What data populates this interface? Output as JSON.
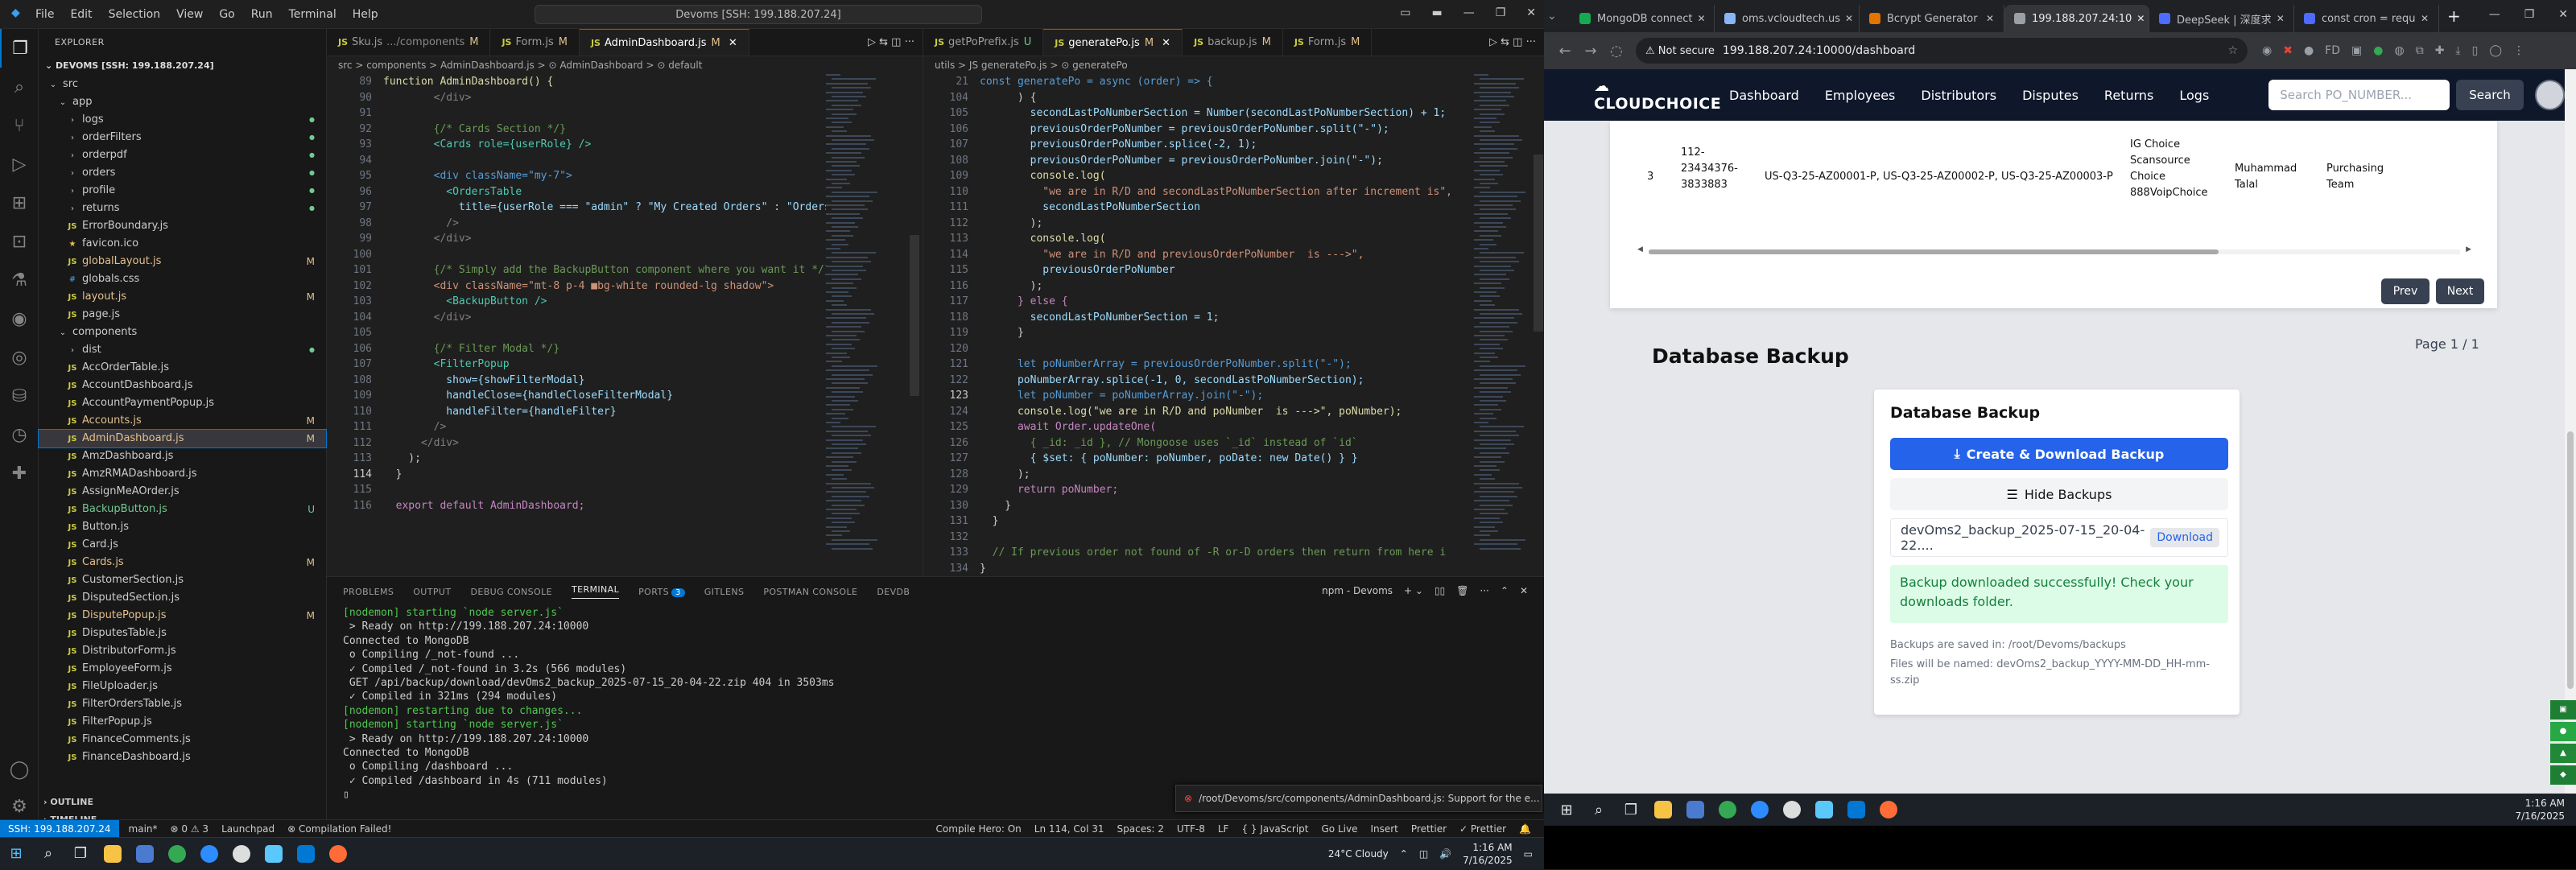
{
  "vscode": {
    "menu": [
      "File",
      "Edit",
      "Selection",
      "View",
      "Go",
      "Run",
      "Terminal",
      "Help"
    ],
    "command_center": "Devoms [SSH: 199.188.207.24]",
    "explorer_label": "EXPLORER",
    "project": "DEVOMS [SSH: 199.188.207.24]",
    "tree": [
      {
        "label": "src",
        "indent": 0,
        "kind": "folder-open",
        "status": "",
        "sc": ""
      },
      {
        "label": "app",
        "indent": 1,
        "kind": "folder-open",
        "status": "",
        "sc": ""
      },
      {
        "label": "logs",
        "indent": 2,
        "kind": "folder",
        "status": "",
        "sc": ""
      },
      {
        "label": "orderFilters",
        "indent": 2,
        "kind": "folder",
        "status": "",
        "sc": ""
      },
      {
        "label": "orderpdf",
        "indent": 2,
        "kind": "folder",
        "status": "",
        "sc": ""
      },
      {
        "label": "orders",
        "indent": 2,
        "kind": "folder",
        "status": "",
        "sc": ""
      },
      {
        "label": "profile",
        "indent": 2,
        "kind": "folder",
        "status": "",
        "sc": ""
      },
      {
        "label": "returns",
        "indent": 2,
        "kind": "folder",
        "status": "",
        "sc": ""
      },
      {
        "label": "ErrorBoundary.js",
        "indent": 2,
        "kind": "js",
        "status": "",
        "sc": ""
      },
      {
        "label": "favicon.ico",
        "indent": 2,
        "kind": "ico",
        "status": "",
        "sc": ""
      },
      {
        "label": "globalLayout.js",
        "indent": 2,
        "kind": "js",
        "status": "M",
        "sc": "#e2c08d"
      },
      {
        "label": "globals.css",
        "indent": 2,
        "kind": "css",
        "status": "",
        "sc": ""
      },
      {
        "label": "layout.js",
        "indent": 2,
        "kind": "js",
        "status": "M",
        "sc": "#e2c08d"
      },
      {
        "label": "page.js",
        "indent": 2,
        "kind": "js",
        "status": "",
        "sc": ""
      },
      {
        "label": "components",
        "indent": 1,
        "kind": "folder-open",
        "status": "",
        "sc": ""
      },
      {
        "label": "dist",
        "indent": 2,
        "kind": "folder",
        "status": "",
        "sc": ""
      },
      {
        "label": "AccOrderTable.js",
        "indent": 2,
        "kind": "js",
        "status": "",
        "sc": ""
      },
      {
        "label": "AccountDashboard.js",
        "indent": 2,
        "kind": "js",
        "status": "",
        "sc": ""
      },
      {
        "label": "AccountPaymentPopup.js",
        "indent": 2,
        "kind": "js",
        "status": "",
        "sc": ""
      },
      {
        "label": "Accounts.js",
        "indent": 2,
        "kind": "js",
        "status": "M",
        "sc": "#e2c08d"
      },
      {
        "label": "AdminDashboard.js",
        "indent": 2,
        "kind": "js",
        "status": "M",
        "sc": "#e2c08d",
        "sel": true
      },
      {
        "label": "AmzDashboard.js",
        "indent": 2,
        "kind": "js",
        "status": "",
        "sc": ""
      },
      {
        "label": "AmzRMADashboard.js",
        "indent": 2,
        "kind": "js",
        "status": "",
        "sc": ""
      },
      {
        "label": "AssignMeAOrder.js",
        "indent": 2,
        "kind": "js",
        "status": "",
        "sc": ""
      },
      {
        "label": "BackupButton.js",
        "indent": 2,
        "kind": "js",
        "status": "U",
        "sc": "#73c991"
      },
      {
        "label": "Button.js",
        "indent": 2,
        "kind": "js",
        "status": "",
        "sc": ""
      },
      {
        "label": "Card.js",
        "indent": 2,
        "kind": "js",
        "status": "",
        "sc": ""
      },
      {
        "label": "Cards.js",
        "indent": 2,
        "kind": "js",
        "status": "M",
        "sc": "#e2c08d"
      },
      {
        "label": "CustomerSection.js",
        "indent": 2,
        "kind": "js",
        "status": "",
        "sc": ""
      },
      {
        "label": "DisputedSection.js",
        "indent": 2,
        "kind": "js",
        "status": "",
        "sc": ""
      },
      {
        "label": "DisputePopup.js",
        "indent": 2,
        "kind": "js",
        "status": "M",
        "sc": "#e2c08d"
      },
      {
        "label": "DisputesTable.js",
        "indent": 2,
        "kind": "js",
        "status": "",
        "sc": ""
      },
      {
        "label": "DistributorForm.js",
        "indent": 2,
        "kind": "js",
        "status": "",
        "sc": ""
      },
      {
        "label": "EmployeeForm.js",
        "indent": 2,
        "kind": "js",
        "status": "",
        "sc": ""
      },
      {
        "label": "FileUploader.js",
        "indent": 2,
        "kind": "js",
        "status": "",
        "sc": ""
      },
      {
        "label": "FilterOrdersTable.js",
        "indent": 2,
        "kind": "js",
        "status": "",
        "sc": ""
      },
      {
        "label": "FilterPopup.js",
        "indent": 2,
        "kind": "js",
        "status": "",
        "sc": ""
      },
      {
        "label": "FinanceComments.js",
        "indent": 2,
        "kind": "js",
        "status": "",
        "sc": ""
      },
      {
        "label": "FinanceDashboard.js",
        "indent": 2,
        "kind": "js",
        "status": "",
        "sc": ""
      }
    ],
    "outline": "OUTLINE",
    "timeline": "TIMELINE",
    "left_tabs": [
      {
        "label": "Sku.js",
        "desc": ".../components",
        "status": "M",
        "active": false
      },
      {
        "label": "Form.js",
        "desc": "",
        "status": "M",
        "active": false
      },
      {
        "label": "AdminDashboard.js",
        "desc": "",
        "status": "M",
        "active": true
      }
    ],
    "left_crumb": "src > components > AdminDashboard.js > ⊙ AdminDashboard > ⊙ default",
    "left_code": [
      {
        "n": "89",
        "t": "function AdminDashboard() {",
        "c": "#dcdcaa"
      },
      {
        "n": "90",
        "t": "        </div>",
        "c": "#808080"
      },
      {
        "n": "91",
        "t": "",
        "c": "#ccc"
      },
      {
        "n": "92",
        "t": "        {/* Cards Section */}",
        "c": "#6a9955"
      },
      {
        "n": "93",
        "t": "        <Cards role={userRole} />",
        "c": "#4ec9b0"
      },
      {
        "n": "94",
        "t": "",
        "c": "#ccc"
      },
      {
        "n": "95",
        "t": "        <div className=\"my-7\">",
        "c": "#569cd6"
      },
      {
        "n": "96",
        "t": "          <OrdersTable",
        "c": "#4ec9b0"
      },
      {
        "n": "97",
        "t": "            title={userRole === \"admin\" ? \"My Created Orders\" : \"Orders\"}",
        "c": "#9cdcfe"
      },
      {
        "n": "98",
        "t": "          />",
        "c": "#808080"
      },
      {
        "n": "99",
        "t": "        </div>",
        "c": "#808080"
      },
      {
        "n": "100",
        "t": "",
        "c": "#ccc"
      },
      {
        "n": "101",
        "t": "        {/* Simply add the BackupButton component where you want it */}",
        "c": "#6a9955"
      },
      {
        "n": "102",
        "t": "        <div className=\"mt-8 p-4 ■bg-white rounded-lg shadow\">",
        "c": "#ce9178"
      },
      {
        "n": "103",
        "t": "          <BackupButton />",
        "c": "#4ec9b0"
      },
      {
        "n": "104",
        "t": "        </div>",
        "c": "#808080"
      },
      {
        "n": "105",
        "t": "",
        "c": "#ccc"
      },
      {
        "n": "106",
        "t": "        {/* Filter Modal */}",
        "c": "#6a9955"
      },
      {
        "n": "107",
        "t": "        <FilterPopup",
        "c": "#4ec9b0"
      },
      {
        "n": "108",
        "t": "          show={showFilterModal}",
        "c": "#9cdcfe"
      },
      {
        "n": "109",
        "t": "          handleClose={handleCloseFilterModal}",
        "c": "#9cdcfe"
      },
      {
        "n": "110",
        "t": "          handleFilter={handleFilter}",
        "c": "#9cdcfe"
      },
      {
        "n": "111",
        "t": "        />",
        "c": "#808080"
      },
      {
        "n": "112",
        "t": "      </div>",
        "c": "#808080"
      },
      {
        "n": "113",
        "t": "    );",
        "c": "#ccc"
      },
      {
        "n": "114",
        "t": "  }",
        "c": "#ccc"
      },
      {
        "n": "115",
        "t": "",
        "c": "#ccc"
      },
      {
        "n": "116",
        "t": "  export default AdminDashboard;",
        "c": "#c586c0"
      }
    ],
    "right_tabs": [
      {
        "label": "getPoPrefix.js",
        "desc": "",
        "status": "U",
        "active": false
      },
      {
        "label": "generatePo.js",
        "desc": "",
        "status": "M",
        "active": true
      },
      {
        "label": "backup.js",
        "desc": "",
        "status": "M",
        "active": false
      },
      {
        "label": "Form.js",
        "desc": "",
        "status": "M",
        "active": false
      }
    ],
    "right_crumb": "utils > JS generatePo.js > ⊙ generatePo",
    "right_code": [
      {
        "n": "21",
        "t": "const generatePo = async (order) => {",
        "c": "#569cd6"
      },
      {
        "n": "104",
        "t": "      ) {",
        "c": "#ccc"
      },
      {
        "n": "105",
        "t": "        secondLastPoNumberSection = Number(secondLastPoNumberSection) + 1;",
        "c": "#9cdcfe"
      },
      {
        "n": "106",
        "t": "        previousOrderPoNumber = previousOrderPoNumber.split(\"-\");",
        "c": "#9cdcfe"
      },
      {
        "n": "107",
        "t": "        previousOrderPoNumber.splice(-2, 1);",
        "c": "#9cdcfe"
      },
      {
        "n": "108",
        "t": "        previousOrderPoNumber = previousOrderPoNumber.join(\"-\");",
        "c": "#9cdcfe"
      },
      {
        "n": "109",
        "t": "        console.log(",
        "c": "#dcdcaa"
      },
      {
        "n": "110",
        "t": "          \"we are in R/D and secondLastPoNumberSection after increment is\",",
        "c": "#ce9178"
      },
      {
        "n": "111",
        "t": "          secondLastPoNumberSection",
        "c": "#9cdcfe"
      },
      {
        "n": "112",
        "t": "        );",
        "c": "#ccc"
      },
      {
        "n": "113",
        "t": "        console.log(",
        "c": "#dcdcaa"
      },
      {
        "n": "114",
        "t": "          \"we are in R/D and previousOrderPoNumber  is --->\",",
        "c": "#ce9178"
      },
      {
        "n": "115",
        "t": "          previousOrderPoNumber",
        "c": "#9cdcfe"
      },
      {
        "n": "116",
        "t": "        );",
        "c": "#ccc"
      },
      {
        "n": "117",
        "t": "      } else {",
        "c": "#c586c0"
      },
      {
        "n": "118",
        "t": "        secondLastPoNumberSection = 1;",
        "c": "#9cdcfe"
      },
      {
        "n": "119",
        "t": "      }",
        "c": "#ccc"
      },
      {
        "n": "120",
        "t": "",
        "c": "#ccc"
      },
      {
        "n": "121",
        "t": "      let poNumberArray = previousOrderPoNumber.split(\"-\");",
        "c": "#569cd6"
      },
      {
        "n": "122",
        "t": "      poNumberArray.splice(-1, 0, secondLastPoNumberSection);",
        "c": "#9cdcfe"
      },
      {
        "n": "123",
        "t": "      let poNumber = poNumberArray.join(\"-\");",
        "c": "#569cd6"
      },
      {
        "n": "124",
        "t": "      console.log(\"we are in R/D and poNumber  is --->\", poNumber);",
        "c": "#dcdcaa"
      },
      {
        "n": "125",
        "t": "      await Order.updateOne(",
        "c": "#c586c0"
      },
      {
        "n": "126",
        "t": "        { _id: _id }, // Mongoose uses `_id` instead of `id`",
        "c": "#6a9955"
      },
      {
        "n": "127",
        "t": "        { $set: { poNumber: poNumber, poDate: new Date() } }",
        "c": "#9cdcfe"
      },
      {
        "n": "128",
        "t": "      );",
        "c": "#ccc"
      },
      {
        "n": "129",
        "t": "      return poNumber;",
        "c": "#c586c0"
      },
      {
        "n": "130",
        "t": "    }",
        "c": "#ccc"
      },
      {
        "n": "131",
        "t": "  }",
        "c": "#ccc"
      },
      {
        "n": "132",
        "t": "",
        "c": "#ccc"
      },
      {
        "n": "133",
        "t": "  // If previous order not found of -R or-D orders then return from here i",
        "c": "#6a9955"
      },
      {
        "n": "134",
        "t": "}",
        "c": "#ccc"
      }
    ],
    "panel_tabs": [
      "PROBLEMS",
      "OUTPUT",
      "DEBUG CONSOLE",
      "TERMINAL",
      "PORTS",
      "GITLENS",
      "POSTMAN CONSOLE",
      "DEVDB"
    ],
    "ports_badge": "3",
    "terminal_name": "npm - Devoms",
    "terminal": [
      {
        "t": "[nodemon] starting `node server.js`",
        "c": "#4ec94e"
      },
      {
        "t": " > Ready on http://199.188.207.24:10000",
        "c": "#ccc"
      },
      {
        "t": "Connected to MongoDB",
        "c": "#ccc"
      },
      {
        "t": " o Compiling /_not-found ...",
        "c": "#ccc"
      },
      {
        "t": " ✓ Compiled /_not-found in 3.2s (566 modules)",
        "c": "#ccc"
      },
      {
        "t": " GET /api/backup/download/devOms2_backup_2025-07-15_20-04-22.zip 404 in 3503ms",
        "c": "#ccc"
      },
      {
        "t": " ✓ Compiled in 321ms (294 modules)",
        "c": "#ccc"
      },
      {
        "t": "[nodemon] restarting due to changes...",
        "c": "#4ec94e"
      },
      {
        "t": "[nodemon] starting `node server.js`",
        "c": "#4ec94e"
      },
      {
        "t": " > Ready on http://199.188.207.24:10000",
        "c": "#ccc"
      },
      {
        "t": "Connected to MongoDB",
        "c": "#ccc"
      },
      {
        "t": " o Compiling /dashboard ...",
        "c": "#ccc"
      },
      {
        "t": " ✓ Compiled /dashboard in 4s (711 modules)",
        "c": "#ccc"
      },
      {
        "t": "▯",
        "c": "#ccc"
      }
    ],
    "toast": "/root/Devoms/src/components/AdminDashboard.js: Support for the e...",
    "status": {
      "remote": "SSH: 199.188.207.24",
      "branch": "main*",
      "errors": "⊗ 0  ⚠ 3",
      "launchpad": "Launchpad",
      "compile": "⊗ Compilation Failed!",
      "hero": "Compile Hero: On",
      "pos": "Ln 114, Col 31",
      "spaces": "Spaces: 2",
      "enc": "UTF-8",
      "eol": "LF",
      "lang": "{ } JavaScript",
      "golive": "Go Live",
      "insert": "Insert",
      "prettier": "Prettier",
      "prettier2": "✓ Prettier"
    }
  },
  "chrome": {
    "tabs": [
      {
        "label": "MongoDB connect",
        "color": "#13aa52",
        "active": false
      },
      {
        "label": "oms.vcloudtech.us",
        "color": "#8ab4f8",
        "active": false
      },
      {
        "label": "Bcrypt Generator",
        "color": "#e37400",
        "active": false
      },
      {
        "label": "199.188.207.24:10",
        "color": "#9aa0a6",
        "active": true
      },
      {
        "label": "DeepSeek | 深度求",
        "color": "#4d6bfe",
        "active": false
      },
      {
        "label": "const cron = requ",
        "color": "#4d6bfe",
        "active": false
      }
    ],
    "not_secure": "Not secure",
    "url": "199.188.207.24:10000/dashboard"
  },
  "app": {
    "brand": "CLOUDCHOICE",
    "nav": [
      "Dashboard",
      "Employees",
      "Distributors",
      "Disputes",
      "Returns",
      "Logs"
    ],
    "search_placeholder": "Search PO_NUMBER...",
    "search_btn": "Search",
    "order_row": {
      "idx": "3",
      "order": "112-23434376-3833883",
      "skus": "US-Q3-25-AZ00001-P, US-Q3-25-AZ00002-P, US-Q3-25-AZ00003-P",
      "customer": "IG Choice Scansource Choice 888VoipChoice",
      "assigned": "Muhammad Talal",
      "team": "Purchasing Team"
    },
    "prev": "Prev",
    "next": "Next",
    "page": "Page 1 / 1",
    "db_title": "Database Backup",
    "card_title": "Database Backup",
    "create_btn": "Create & Download Backup",
    "hide_btn": "Hide Backups",
    "backup_file": "devOms2_backup_2025-07-15_20-04-22....",
    "download": "Download",
    "success": "Backup downloaded successfully! Check your downloads folder.",
    "saved_in": "Backups are saved in: /root/Devoms/backups",
    "named": "Files will be named: devOms2_backup_YYYY-MM-DD_HH-mm-ss.zip"
  },
  "taskbar": {
    "weather": "24°C  Cloudy",
    "time": "1:16 AM",
    "date": "7/16/2025",
    "time2": "1:16 AM",
    "date2": "7/16/2025"
  }
}
